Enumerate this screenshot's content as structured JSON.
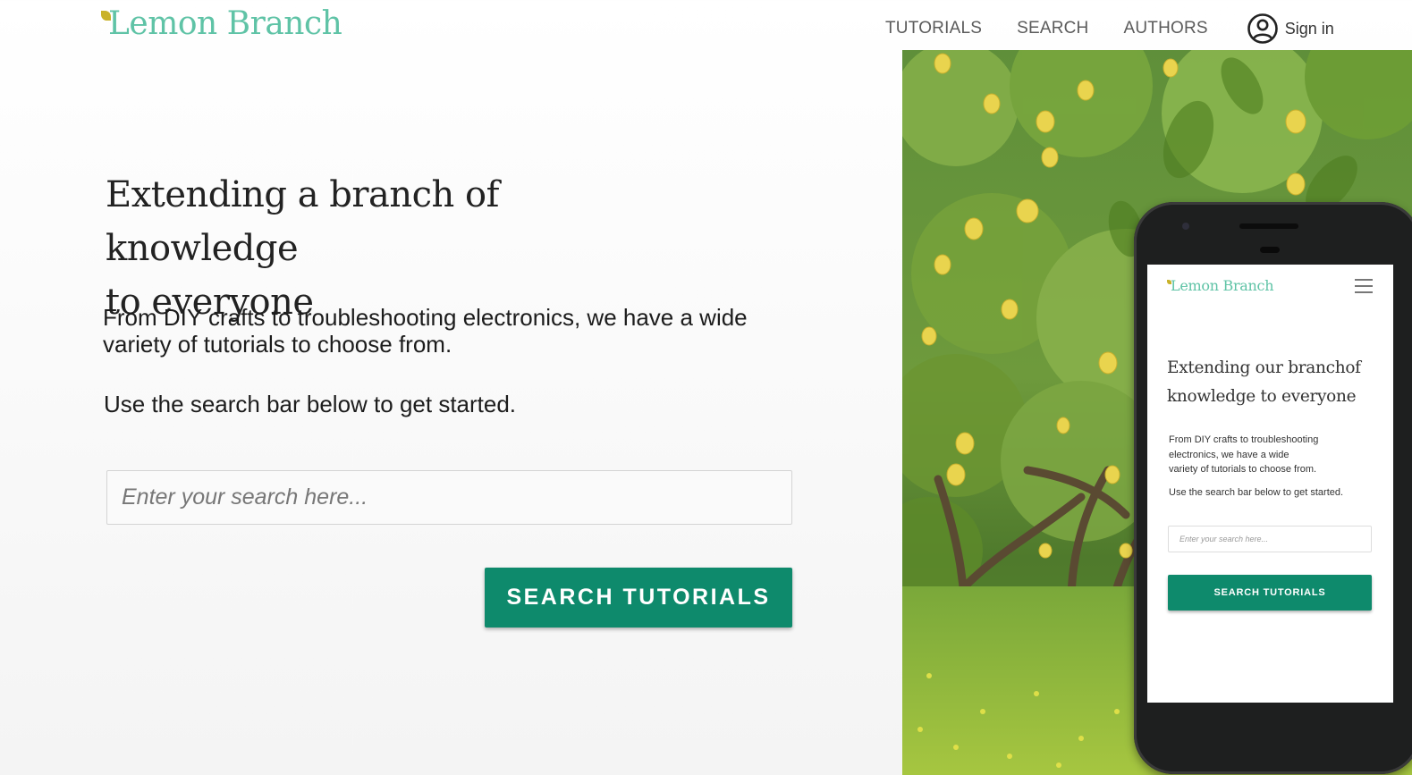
{
  "brand": {
    "name": "Lemon Branch",
    "color": "#5fc3a6",
    "leaf_color": "#c9b22a"
  },
  "nav": {
    "items": [
      {
        "label": "TUTORIALS"
      },
      {
        "label": "SEARCH"
      },
      {
        "label": "AUTHORS"
      }
    ],
    "signin_label": "Sign in",
    "signin_icon": "account-circle-icon"
  },
  "hero": {
    "headline_line1": "Extending a branch of knowledge",
    "headline_line2": "to everyone",
    "lead": "From DIY crafts to troubleshooting electronics, we have a wide variety of tutorials to choose from.",
    "lead2": "Use the search bar below to get started.",
    "search_placeholder": "Enter your search here...",
    "search_value": "",
    "button_label": "SEARCH TUTORIALS",
    "accent": "#0e8a6c"
  },
  "mobile": {
    "logo": "Lemon Branch",
    "menu_icon": "hamburger-menu-icon",
    "headline_line1": "Extending our branchof",
    "headline_line2": "knowledge to everyone",
    "lead_line1": "From DIY crafts to troubleshooting",
    "lead_line2": "electronics, we have a wide",
    "lead_line3": "variety of tutorials to choose from.",
    "lead2": "Use the search bar below to get started.",
    "search_placeholder": "Enter your search here...",
    "button_label": "SEARCH TUTORIALS"
  },
  "photo": {
    "subject": "lemon-grove-photo"
  }
}
